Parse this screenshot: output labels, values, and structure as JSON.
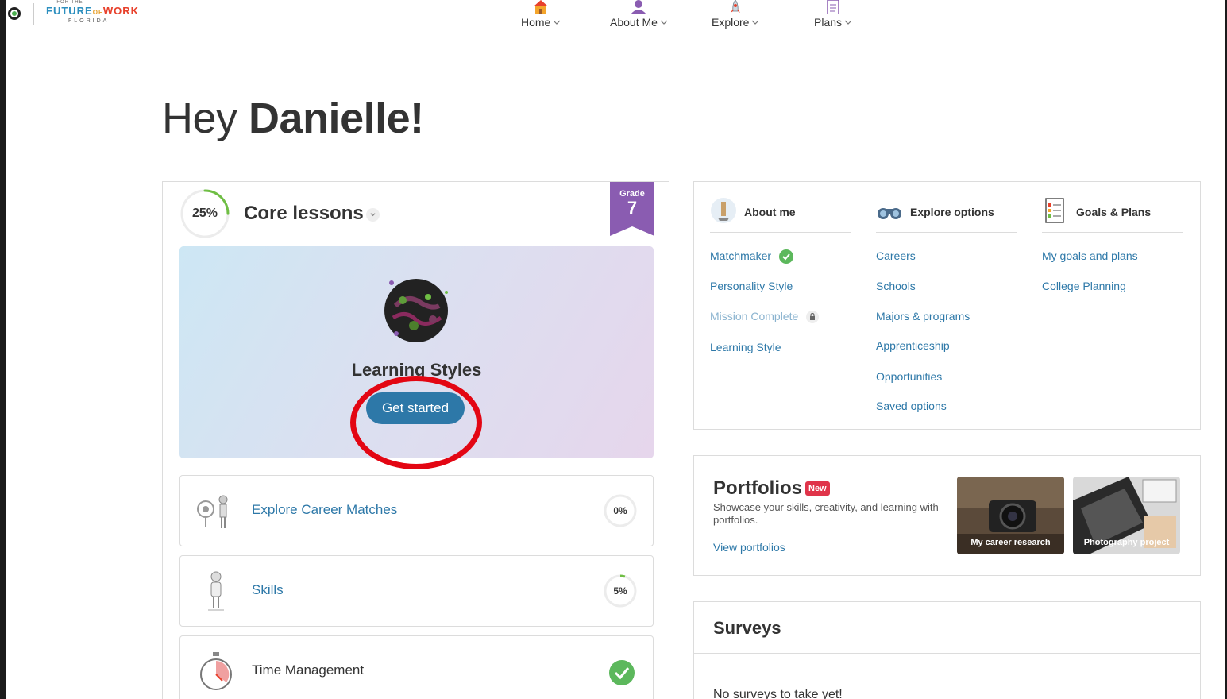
{
  "nav": {
    "logo": {
      "top": "FOR THE",
      "future": "FUTURE",
      "of": "OF",
      "work": "WORK",
      "state": "FLORIDA"
    },
    "items": [
      {
        "label": "Home",
        "icon": "house-icon"
      },
      {
        "label": "About Me",
        "icon": "person-icon"
      },
      {
        "label": "Explore",
        "icon": "rocket-icon"
      },
      {
        "label": "Plans",
        "icon": "clipboard-icon"
      }
    ]
  },
  "greeting": {
    "prefix": "Hey",
    "name": "Danielle!"
  },
  "core": {
    "progress_label": "25%",
    "progress_value": 0.25,
    "title": "Core lessons",
    "grade_label": "Grade",
    "grade_value": "7",
    "hero": {
      "title": "Learning Styles",
      "button": "Get started"
    },
    "lessons": [
      {
        "label": "Explore Career Matches",
        "progress_label": "0%",
        "progress_value": 0.0,
        "icon": "career-matches-icon"
      },
      {
        "label": "Skills",
        "progress_label": "5%",
        "progress_value": 0.05,
        "icon": "skills-icon"
      },
      {
        "label": "Time Management",
        "status": "complete",
        "icon": "stopwatch-icon"
      }
    ]
  },
  "links": {
    "about": {
      "title": "About me",
      "items": [
        "Matchmaker",
        "Personality Style",
        "Mission Complete",
        "Learning Style"
      ]
    },
    "explore": {
      "title": "Explore options",
      "items": [
        "Careers",
        "Schools",
        "Majors & programs",
        "Apprenticeship",
        "Opportunities",
        "Saved options"
      ]
    },
    "goals": {
      "title": "Goals & Plans",
      "items": [
        "My goals and plans",
        "College Planning"
      ]
    }
  },
  "portfolios": {
    "title": "Portfolios",
    "badge": "New",
    "description": "Showcase your skills, creativity, and learning with portfolios.",
    "link": "View portfolios",
    "thumbs": [
      "My career research",
      "Photography project"
    ]
  },
  "surveys": {
    "title": "Surveys",
    "empty": "No surveys to take yet!"
  },
  "colors": {
    "accent_blue": "#2d78a8",
    "grade_purple": "#8a5cb1",
    "success_green": "#5cb85c",
    "annotation_red": "#e30613"
  }
}
